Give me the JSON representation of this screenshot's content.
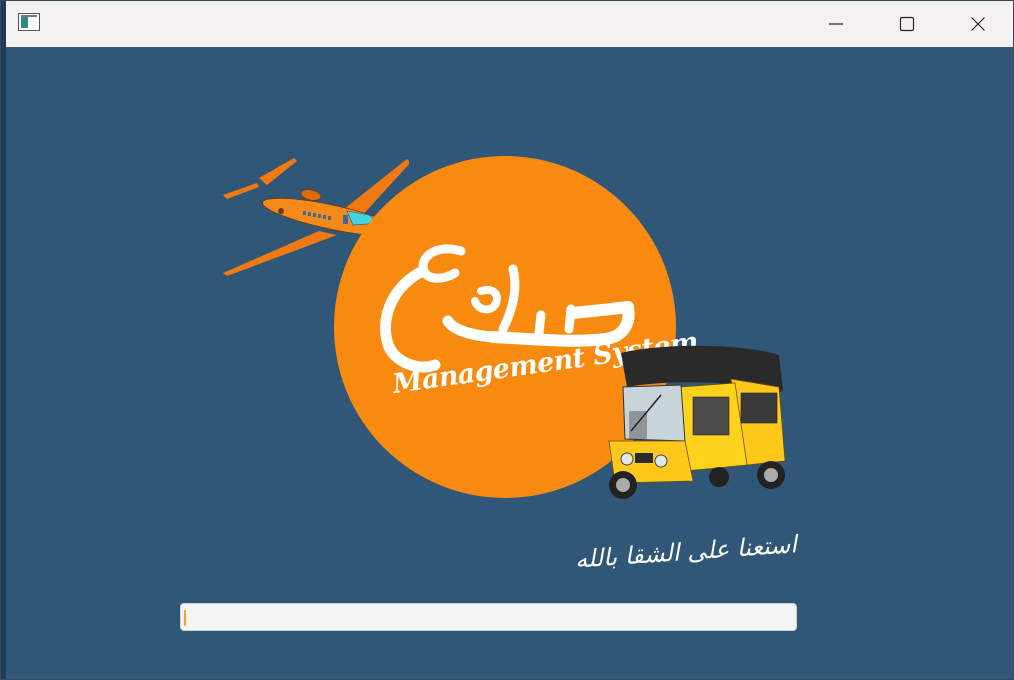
{
  "window": {
    "title": "",
    "controls": {
      "minimize_icon": "minimize-icon",
      "maximize_icon": "maximize-icon",
      "close_icon": "close-icon"
    }
  },
  "logo": {
    "arabic_text": "سواح",
    "english_text": "Management System",
    "circle_color": "#f98a10"
  },
  "tagline": "استعنا على الشقا بالله",
  "progress": {
    "value": 0.004
  },
  "colors": {
    "background": "#305778",
    "accent": "#f98a10",
    "titlebar": "#f4f2f0"
  }
}
